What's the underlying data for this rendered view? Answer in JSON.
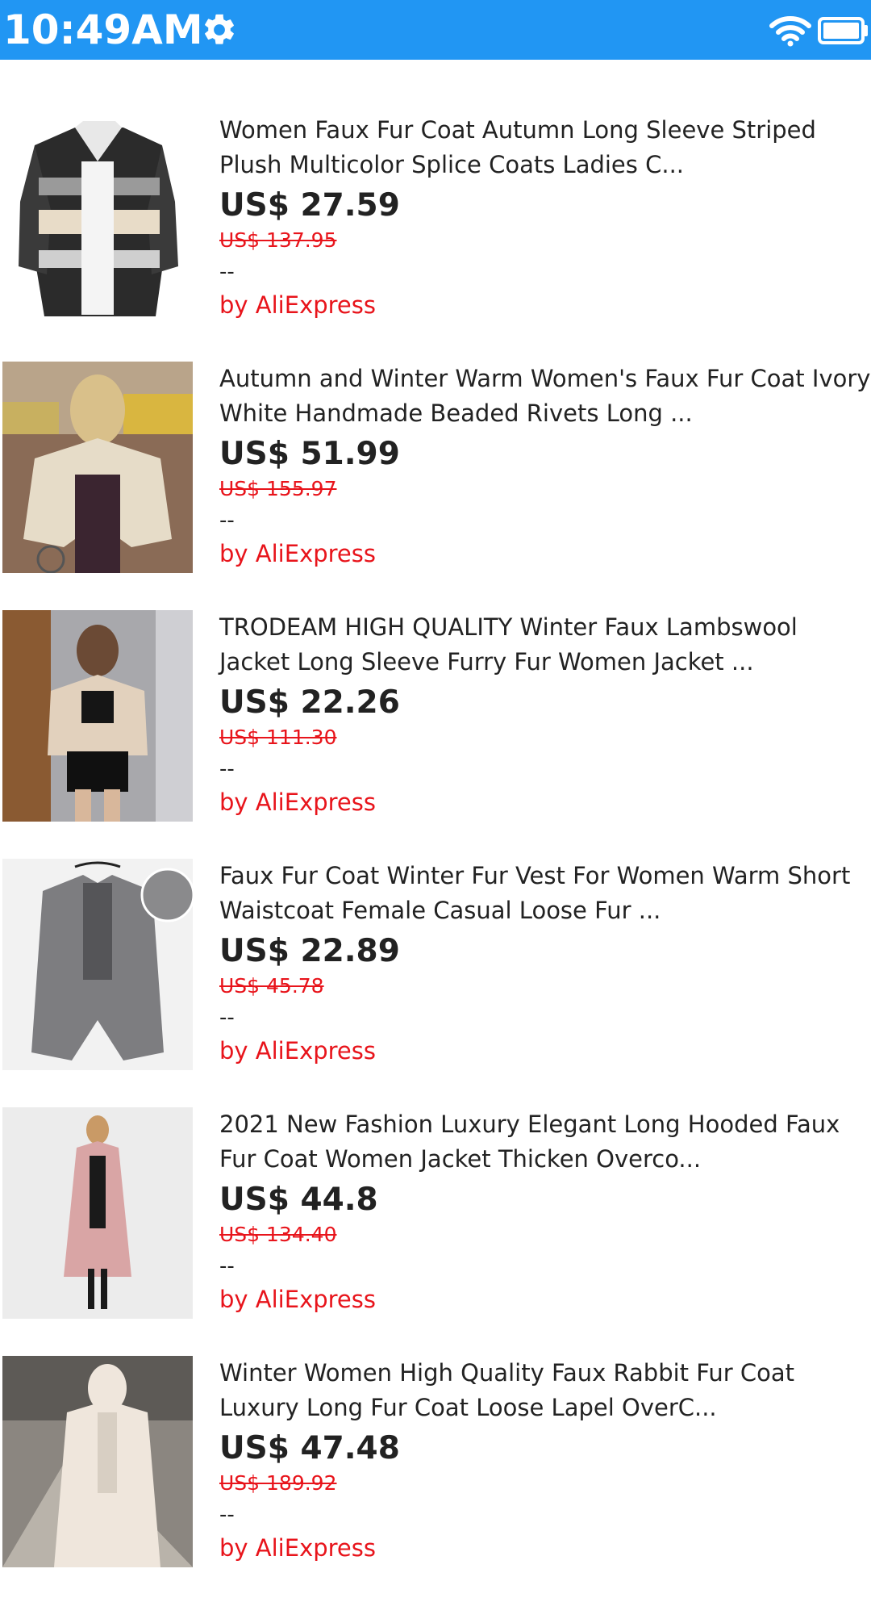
{
  "status_bar": {
    "time": "10:49AM",
    "icons": [
      "gear-icon",
      "wifi-icon",
      "battery-icon"
    ],
    "color": "#2196F3"
  },
  "products": [
    {
      "title_line1": "Women Faux Fur Coat Autumn Long Sleeve Striped",
      "title_line2": "Plush Multicolor Splice Coats Ladies C...",
      "price": "US$ 27.59",
      "original_price": "US$ 137.95",
      "rating": "--",
      "seller": "by AliExpress"
    },
    {
      "title_line1": "Autumn and Winter Warm Women's Faux Fur Coat Ivory",
      "title_line2": "White Handmade Beaded Rivets Long ...",
      "price": "US$ 51.99",
      "original_price": "US$ 155.97",
      "rating": "--",
      "seller": "by AliExpress"
    },
    {
      "title_line1": "TRODEAM HIGH QUALITY Winter Faux Lambswool",
      "title_line2": "Jacket Long Sleeve Furry Fur Women Jacket ...",
      "price": "US$ 22.26",
      "original_price": "US$ 111.30",
      "rating": "--",
      "seller": "by AliExpress"
    },
    {
      "title_line1": "Faux Fur Coat Winter Fur Vest For Women Warm Short",
      "title_line2": "Waistcoat Female Casual Loose Fur ...",
      "price": "US$ 22.89",
      "original_price": "US$ 45.78",
      "rating": "--",
      "seller": "by AliExpress"
    },
    {
      "title_line1": "2021 New Fashion Luxury Elegant Long Hooded Faux",
      "title_line2": "Fur Coat Women Jacket Thicken Overco...",
      "price": "US$ 44.8",
      "original_price": "US$ 134.40",
      "rating": "--",
      "seller": "by AliExpress"
    },
    {
      "title_line1": "Winter Women High Quality Faux Rabbit Fur Coat",
      "title_line2": "Luxury Long Fur Coat Loose Lapel OverC...",
      "price": "US$ 47.48",
      "original_price": "US$ 189.92",
      "rating": "--",
      "seller": "by AliExpress"
    }
  ],
  "colors": {
    "accent": "#2196F3",
    "sale_red": "#e8141b",
    "text": "#222222"
  }
}
